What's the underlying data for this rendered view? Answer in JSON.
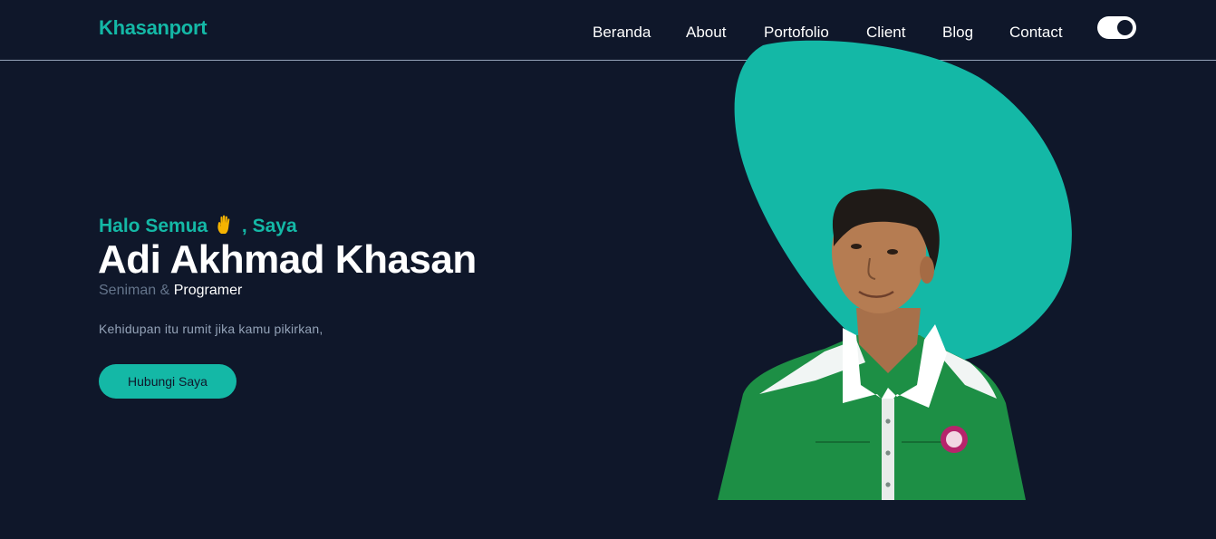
{
  "brand": {
    "name": "Khasanport"
  },
  "nav": {
    "items": [
      {
        "label": "Beranda"
      },
      {
        "label": "About"
      },
      {
        "label": "Portofolio"
      },
      {
        "label": "Client"
      },
      {
        "label": "Blog"
      },
      {
        "label": "Contact"
      }
    ],
    "theme_toggle": {
      "state": "on"
    }
  },
  "hero": {
    "greeting_prefix": "Halo Semua",
    "greeting_suffix": ", Saya",
    "name": "Adi Akhmad Khasan",
    "role_1": "Seniman",
    "role_separator": "&",
    "role_2": "Programer",
    "tagline": "Kehidupan itu rumit jika kamu pikirkan,",
    "cta_label": "Hubungi Saya",
    "image_icon": "portrait-photo"
  },
  "colors": {
    "background": "#0f172a",
    "accent": "#14b8a6",
    "text_primary": "#ffffff",
    "text_muted": "#94a3b8"
  }
}
